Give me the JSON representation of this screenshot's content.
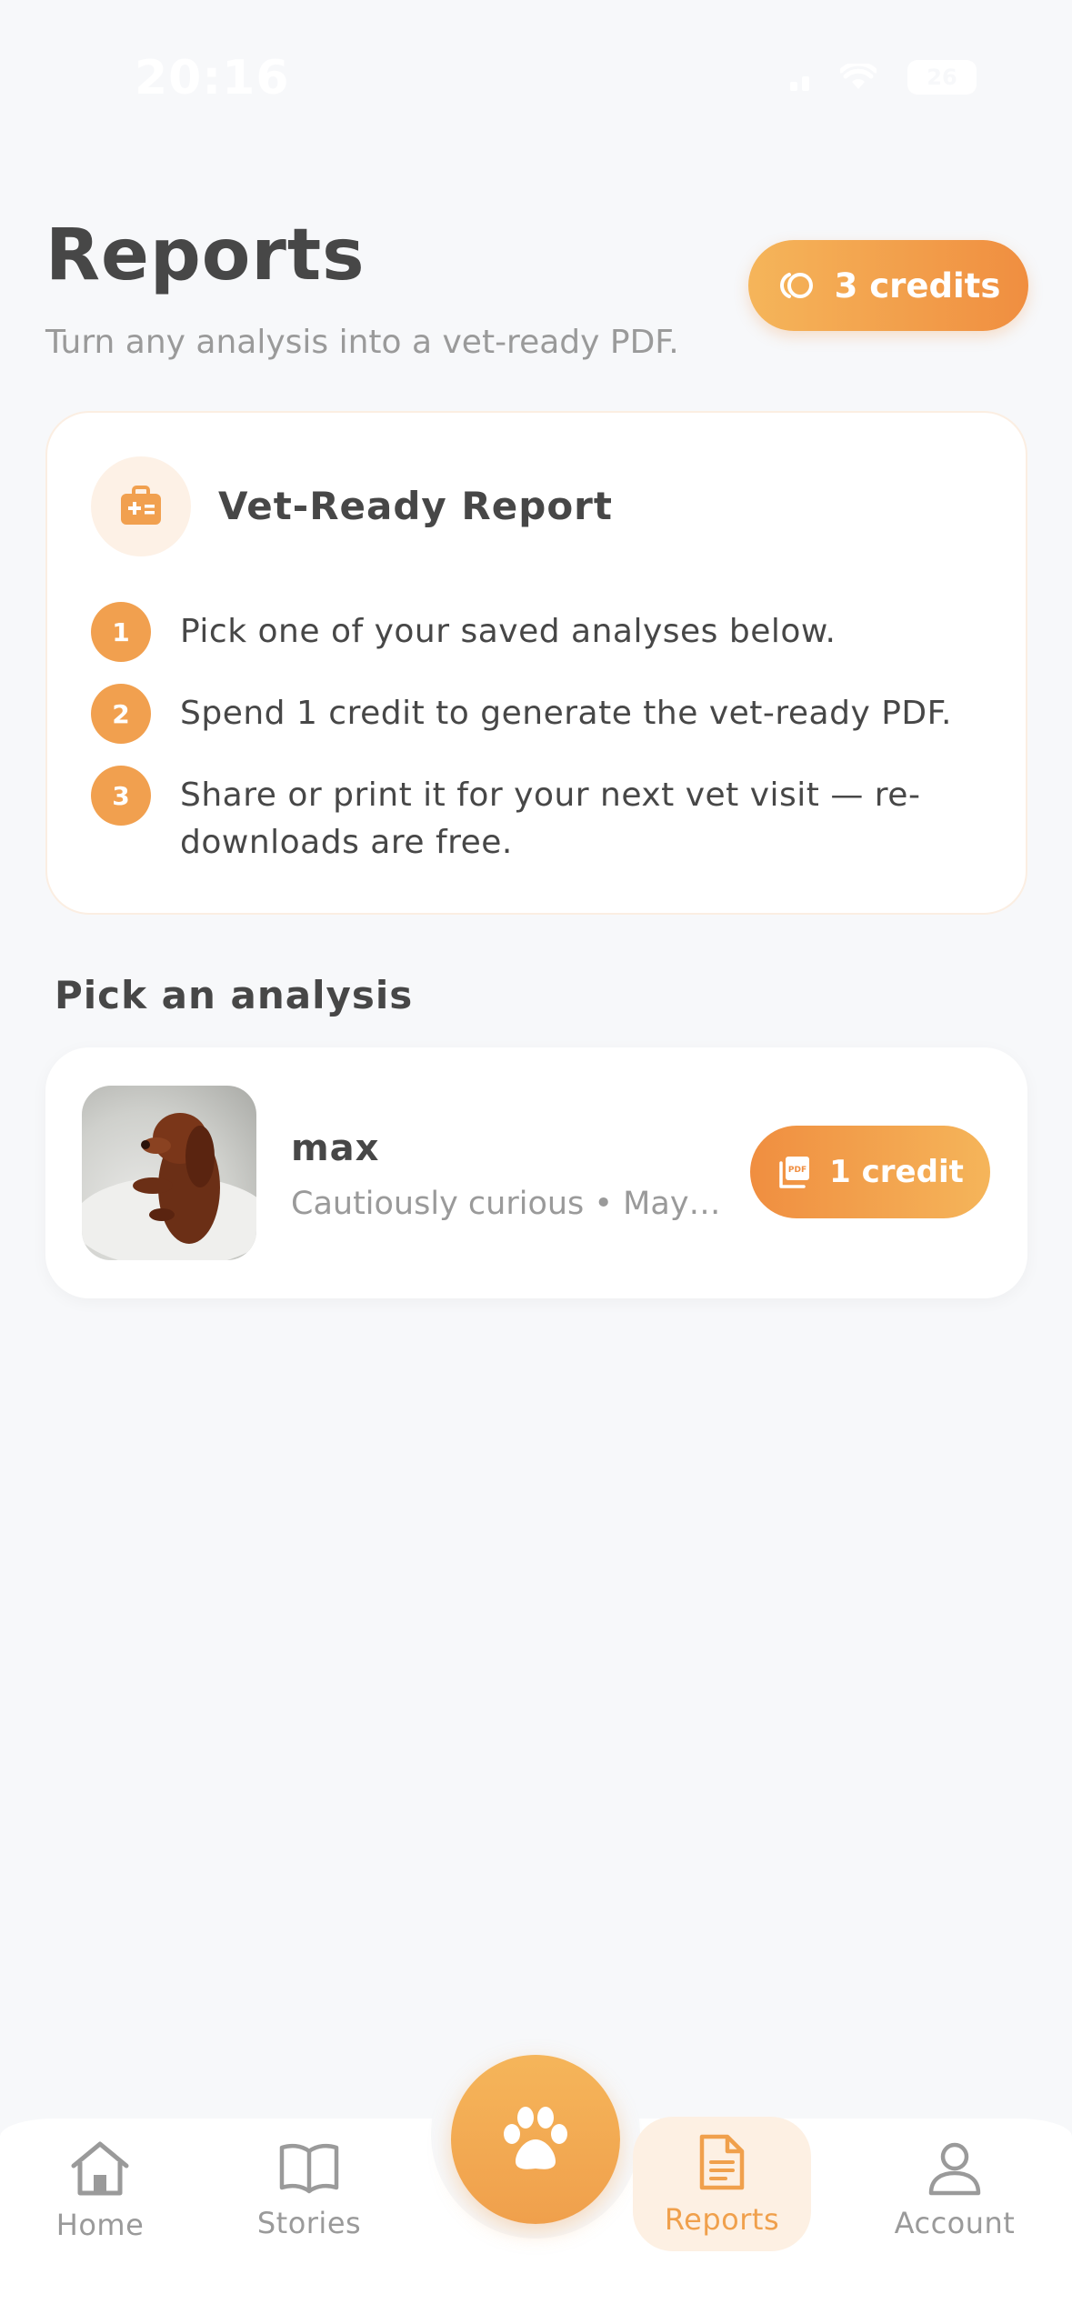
{
  "status_bar": {
    "time": "20:16",
    "battery": "26"
  },
  "header": {
    "title": "Reports",
    "subtitle": "Turn any analysis into a vet-ready PDF.",
    "credits_label": "3 credits"
  },
  "info_card": {
    "title": "Vet-Ready Report",
    "icon": "medical-kit-icon",
    "steps": [
      {
        "number": "1",
        "text": "Pick one of your saved analyses below."
      },
      {
        "number": "2",
        "text": "Spend 1 credit to generate the vet-ready PDF."
      },
      {
        "number": "3",
        "text": "Share or print it for your next vet visit — re-downloads are free."
      }
    ]
  },
  "section": {
    "title": "Pick an analysis"
  },
  "analyses": [
    {
      "name": "max",
      "meta": "Cautiously curious • May…",
      "button_label": "1 credit"
    }
  ],
  "tab_bar": {
    "items": [
      {
        "label": "Home",
        "icon": "home-icon"
      },
      {
        "label": "Stories",
        "icon": "book-icon"
      },
      {
        "label": "Reports",
        "icon": "document-icon",
        "active": true
      },
      {
        "label": "Account",
        "icon": "person-icon"
      }
    ],
    "center_icon": "paw-icon"
  },
  "colors": {
    "accent": "#f0a04c",
    "accent_light": "#f5b55a",
    "accent_dark": "#f08e40",
    "background": "#f7f8fa",
    "text": "#474747",
    "muted": "#9a9a9a"
  }
}
